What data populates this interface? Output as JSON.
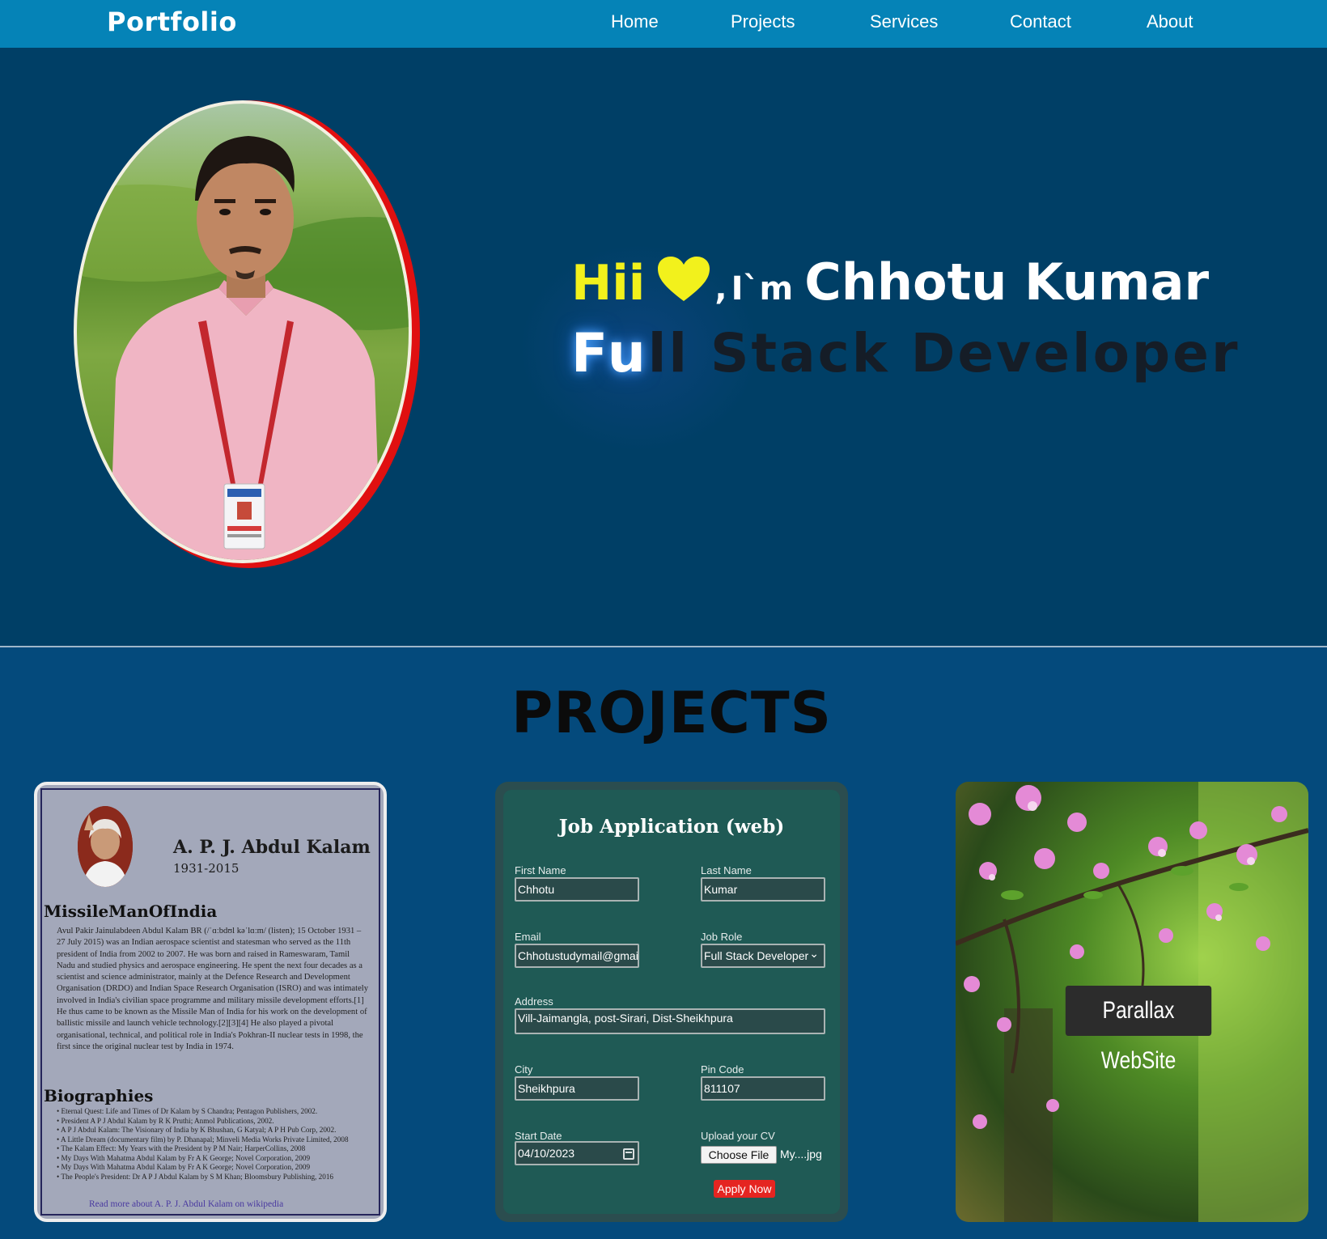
{
  "navbar": {
    "brand": "Portfolio",
    "links": [
      "Home",
      "Projects",
      "Services",
      "Contact",
      "About"
    ]
  },
  "hero": {
    "greeting": "Hii",
    "comma": ",",
    "im": "I`m",
    "name": "Chhotu Kumar",
    "role_typed": "Fu",
    "role_rest": "ll Stack Developer",
    "portrait_alt": "profile-photo"
  },
  "projects": {
    "title": "PROJECTS",
    "card1": {
      "name": "A. P. J. Abdul Kalam",
      "years": "1931-2015",
      "heading": "MissileManOfIndia",
      "paragraph": "Avul Pakir Jainulabdeen Abdul Kalam BR (/ˈɑːbdʊl kəˈlɑːm/ (listen); 15 October 1931 – 27 July 2015) was an Indian aerospace scientist and statesman who served as the 11th president of India from 2002 to 2007. He was born and raised in Rameswaram, Tamil Nadu and studied physics and aerospace engineering. He spent the next four decades as a scientist and science administrator, mainly at the Defence Research and Development Organisation (DRDO) and Indian Space Research Organisation (ISRO) and was intimately involved in India's civilian space programme and military missile development efforts.[1] He thus came to be known as the Missile Man of India for his work on the development of ballistic missile and launch vehicle technology.[2][3][4] He also played a pivotal organisational, technical, and political role in India's Pokhran-II nuclear tests in 1998, the first since the original nuclear test by India in 1974.",
      "bio_heading": "Biographies",
      "biographies": [
        "Eternal Quest: Life and Times of Dr Kalam by S Chandra; Pentagon Publishers, 2002.",
        "President A P J Abdul Kalam by R K Pruthi; Anmol Publications, 2002.",
        "A P J Abdul Kalam: The Visionary of India by K Bhushan, G Katyal; A P H Pub Corp, 2002.",
        "A Little Dream (documentary film) by P. Dhanapal; Minveli Media Works Private Limited, 2008",
        "The Kalam Effect: My Years with the President by P M Nair; HarperCollins, 2008",
        "My Days With Mahatma Abdul Kalam by Fr A K George; Novel Corporation, 2009",
        "My Days With Mahatma Abdul Kalam by Fr A K George; Novel Corporation, 2009",
        "The People's President: Dr A P J Abdul Kalam by S M Khan; Bloomsbury Publishing, 2016"
      ],
      "link": "Read more about A. P. J. Abdul Kalam on wikipedia"
    },
    "card2": {
      "title": "Job Application (web)",
      "first_name_label": "First Name",
      "first_name": "Chhotu",
      "last_name_label": "Last Name",
      "last_name": "Kumar",
      "email_label": "Email",
      "email": "Chhotustudymail@gmail",
      "role_label": "Job Role",
      "role": "Full Stack Developer",
      "address_label": "Address",
      "address": "Vill-Jaimangla, post-Sirari, Dist-Sheikhpura",
      "city_label": "City",
      "city": "Sheikhpura",
      "pin_label": "Pin Code",
      "pin": "811107",
      "date_label": "Start Date",
      "date": "04/10/2023",
      "cv_label": "Upload your CV",
      "choose_file": "Choose File",
      "file_name": "My....jpg",
      "apply": "Apply Now"
    },
    "card3": {
      "label": "Parallax WebSite"
    }
  },
  "colors": {
    "navbar": "#0583b7",
    "hero_bg": "#003f66",
    "page_bg": "#044a7c",
    "accent_yellow": "#f2f11c",
    "apply_red": "#e52521"
  }
}
